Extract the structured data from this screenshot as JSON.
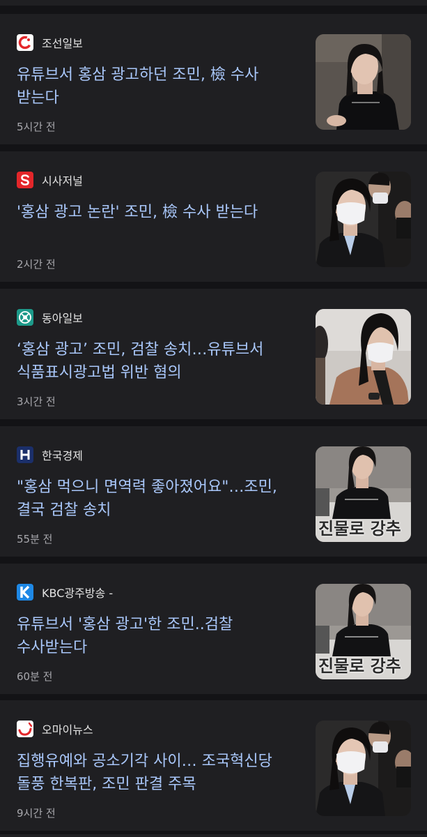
{
  "articles": [
    {
      "source": "조선일보",
      "logo_icon": "chosun-logo-icon",
      "headline": "유튜브서 홍삼 광고하던 조민, 檢 수사 받는다",
      "time": "5시간 전",
      "thumb_icon": "woman-black-tshirt-photo"
    },
    {
      "source": "시사저널",
      "logo_icon": "sisajournal-logo-icon",
      "headline": "'홍삼 광고 논란' 조민, 檢 수사 받는다",
      "time": "2시간 전",
      "thumb_icon": "woman-mask-crowd-photo"
    },
    {
      "source": "동아일보",
      "logo_icon": "donga-logo-icon",
      "headline": "‘홍삼 광고’ 조민, 검찰 송치…유튜브서 식품표시광고법 위반 혐의",
      "time": "3시간 전",
      "thumb_icon": "woman-mask-jacket-photo"
    },
    {
      "source": "한국경제",
      "logo_icon": "hankyung-logo-icon",
      "headline": "\"홍삼 먹으니 면역력 좋아졌어요\"…조민, 결국 검찰 송치",
      "time": "55분 전",
      "thumb_icon": "woman-video-caption-photo"
    },
    {
      "source": "KBC광주방송 -",
      "logo_icon": "kbc-logo-icon",
      "headline": "유튜브서 '홍삼 광고'한 조민..검찰 수사받는다",
      "time": "60분 전",
      "thumb_icon": "woman-video-caption-photo"
    },
    {
      "source": "오마이뉴스",
      "logo_icon": "ohmynews-logo-icon",
      "headline": "집행유예와 공소기각 사이… 조국혁신당 돌풍 한복판, 조민 판결 주목",
      "time": "9시간 전",
      "thumb_icon": "woman-mask-crowd-photo"
    }
  ],
  "thumb_caption": "진물로 강추",
  "colors": {
    "background": "#131316",
    "card": "#1f1f22",
    "headline": "#a9c7fa",
    "source": "#e3e3e3",
    "time": "#a8a8ad"
  }
}
